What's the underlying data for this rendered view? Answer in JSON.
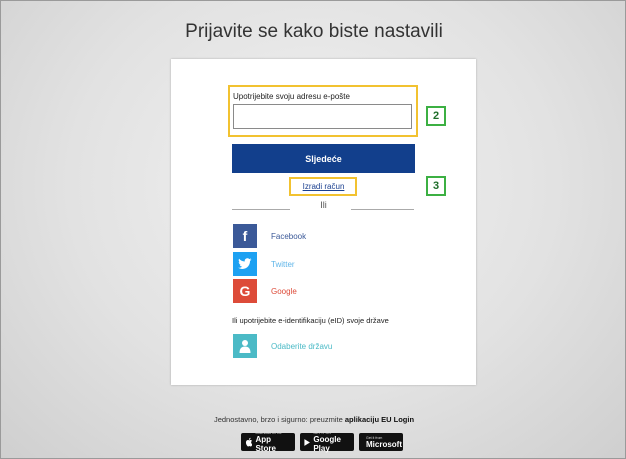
{
  "page": {
    "title": "Prijavite se kako biste nastavili"
  },
  "login": {
    "email_label": "Upotrijebite svoju adresu e-pošte",
    "email_value": "",
    "next_label": "Sljedeće",
    "create_account_label": "Izradi račun",
    "or_label": "Ili"
  },
  "social": [
    {
      "label": "Facebook",
      "icon": "facebook-icon",
      "color": "#3b5998",
      "text_color": "#3b5998"
    },
    {
      "label": "Twitter",
      "icon": "twitter-icon",
      "color": "#1da1f2",
      "text_color": "#5fb5e8"
    },
    {
      "label": "Google",
      "icon": "google-icon",
      "color": "#dd4b39",
      "text_color": "#dd4b39"
    }
  ],
  "eid": {
    "text": "Ili upotrijebite e-identifikaciju (eID) svoje države",
    "choose_country_label": "Odaberite državu",
    "icon": "person-icon",
    "color": "#4bbac6"
  },
  "annotations": {
    "callout_email": "2",
    "callout_create": "3",
    "highlight_color": "#f2c230",
    "callout_color": "#3cb043",
    "arrow_color": "#c8102e"
  },
  "footer": {
    "text_prefix": "Jednostavno, brzo i sigurno: preuzmite ",
    "text_bold": "aplikaciju EU Login",
    "badges": [
      {
        "small": "Download on the",
        "big": "App Store",
        "icon": "apple-icon"
      },
      {
        "small": "GET IT ON",
        "big": "Google Play",
        "icon": "google-play-icon"
      },
      {
        "small": "Get it from",
        "big": "Microsoft",
        "icon": "microsoft-icon"
      }
    ]
  }
}
